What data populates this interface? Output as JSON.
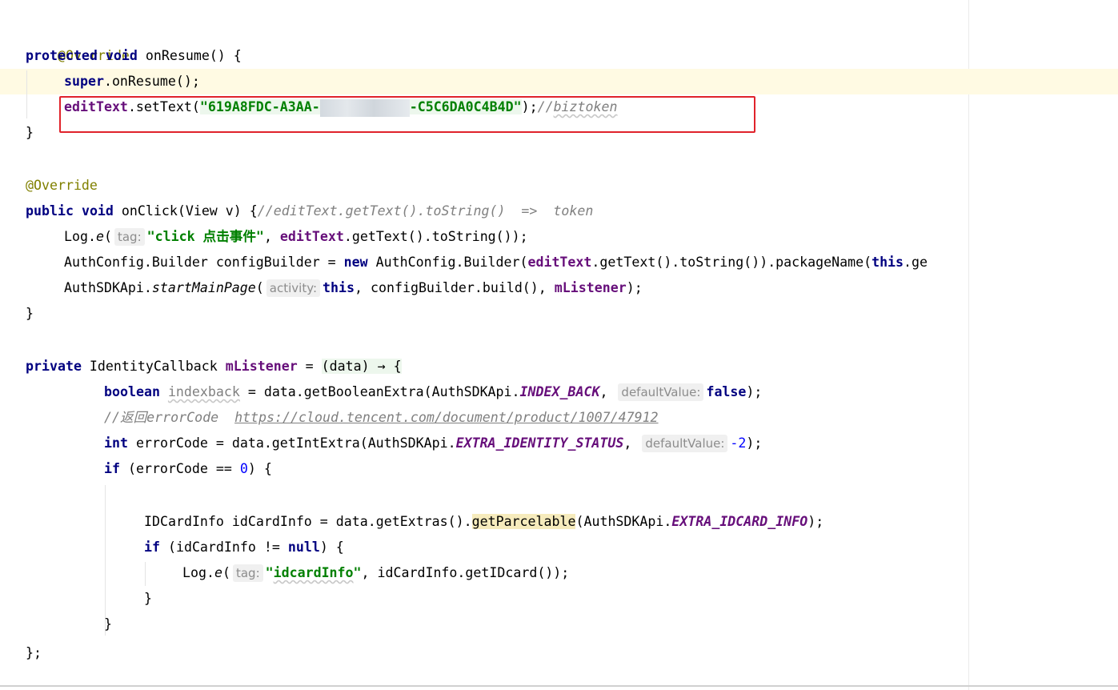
{
  "code": {
    "l1_annotation": "@Override",
    "l2_protected": "protected",
    "l2_void": "void",
    "l2_rest": " onResume() {",
    "l3_super": "super",
    "l3_rest": ".onResume();",
    "l4_field": "editText",
    "l4_call": ".setText(",
    "l4_str_a": "\"619A8FDC-A3AA-",
    "l4_str_b": "-C5C6DA0C4B4D\"",
    "l4_end": ");",
    "l4_comment_prefix": "//",
    "l4_comment_word": "biztoken",
    "l5_brace": "}",
    "l7_annotation": "@Override",
    "l8_public": "public",
    "l8_void": "void",
    "l8_rest": " onClick(View v) {",
    "l8_comment": "//editText.getText().toString()  =>  token",
    "l9_log": "Log.",
    "l9_e": "e",
    "l9_paren": "(",
    "l9_hint": "tag:",
    "l9_str": "\"click 点击事件\"",
    "l9_comma": ", ",
    "l9_field": "editText",
    "l9_rest": ".getText().toString());",
    "l10_a": "AuthConfig.Builder configBuilder = ",
    "l10_new": "new",
    "l10_b": " AuthConfig.Builder(",
    "l10_field": "editText",
    "l10_c": ".getText().toString()).packageName(",
    "l10_this": "this",
    "l10_d": ".ge",
    "l11_a": "AuthSDKApi.",
    "l11_method": "startMainPage",
    "l11_paren": "(",
    "l11_hint": "activity:",
    "l11_this": "this",
    "l11_b": ", configBuilder.build(), ",
    "l11_field": "mListener",
    "l11_end": ");",
    "l12_brace": "}",
    "l14_private": "private",
    "l14_a": " IdentityCallback ",
    "l14_field": "mListener",
    "l14_b": " = ",
    "l14_lambda": "(data) → {",
    "l15_boolean": "boolean",
    "l15_var": "indexback",
    "l15_a": " = data.getBooleanExtra(AuthSDKApi.",
    "l15_const": "INDEX_BACK",
    "l15_comma": ", ",
    "l15_hint": "defaultValue:",
    "l15_false": "false",
    "l15_end": ");",
    "l16_comment_a": "//返回errorCode  ",
    "l16_url": "https://cloud.tencent.com/document/product/1007/47912",
    "l17_int": "int",
    "l17_a": " errorCode = data.getIntExtra(AuthSDKApi.",
    "l17_const": "EXTRA_IDENTITY_STATUS",
    "l17_comma": ", ",
    "l17_hint": "defaultValue:",
    "l17_num": "-2",
    "l17_end": ");",
    "l18_if": "if",
    "l18_a": " (errorCode == ",
    "l18_num": "0",
    "l18_b": ") {",
    "l20_a": "IDCardInfo idCardInfo = data.getExtras().",
    "l20_method": "getParcelable",
    "l20_b": "(AuthSDKApi.",
    "l20_const": "EXTRA_IDCARD_INFO",
    "l20_end": ");",
    "l21_if": "if",
    "l21_a": " (idCardInfo != ",
    "l21_null": "null",
    "l21_b": ") {",
    "l22_log": "Log.",
    "l22_e": "e",
    "l22_paren": "(",
    "l22_hint": "tag:",
    "l22_str_q1": "\"",
    "l22_str_word": "idcardInfo",
    "l22_str_q2": "\"",
    "l22_rest": ", idCardInfo.getIDcard());",
    "l23_brace": "}",
    "l24_brace": "}",
    "l25_end": "};"
  },
  "colors": {
    "keyword": "#000080",
    "field": "#660e7a",
    "string": "#008000",
    "comment": "#808080",
    "annotation": "#808000",
    "number": "#0000ff",
    "highlight_box": "#e0232b"
  }
}
